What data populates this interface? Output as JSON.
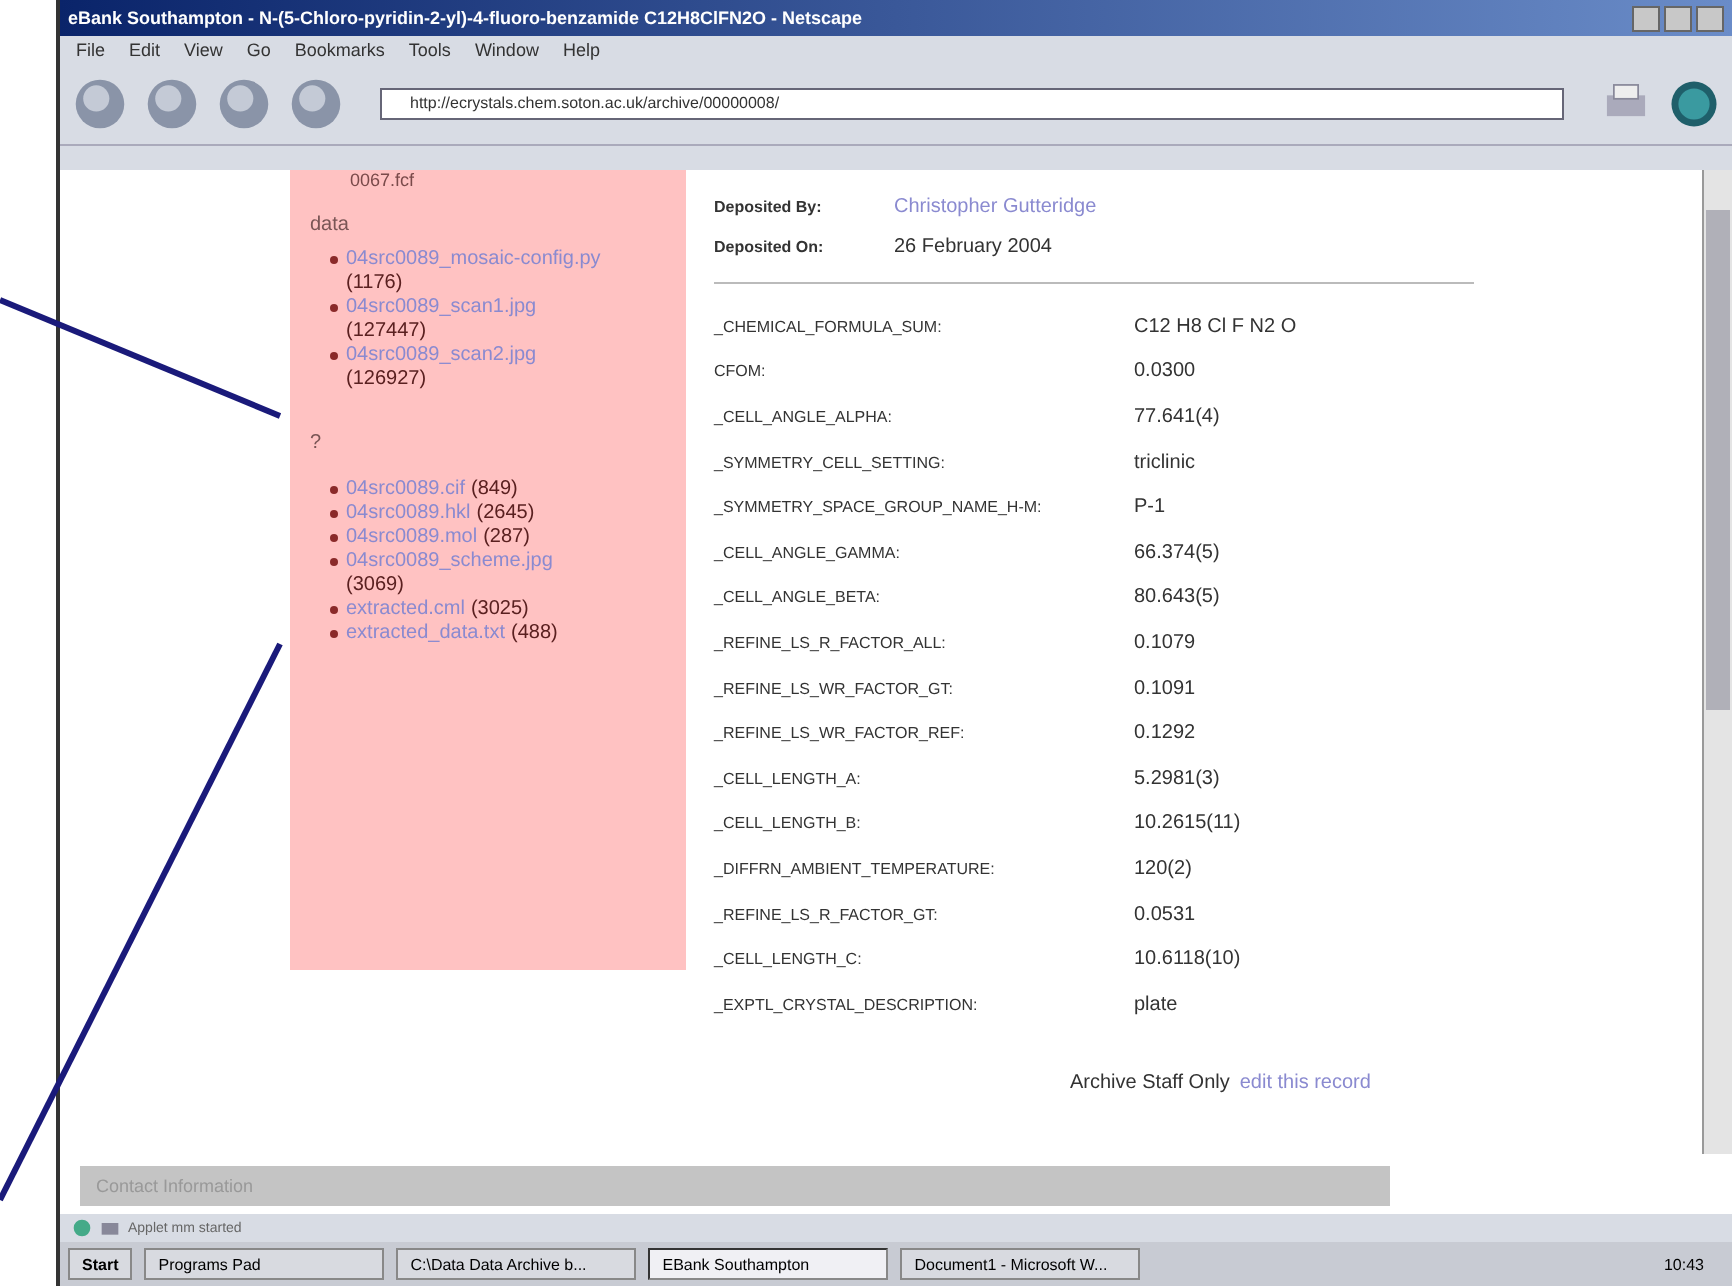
{
  "window": {
    "title": "eBank Southampton - N-(5-Chloro-pyridin-2-yl)-4-fluoro-benzamide C12H8ClFN2O - Netscape"
  },
  "menu": [
    "File",
    "Edit",
    "View",
    "Go",
    "Bookmarks",
    "Tools",
    "Window",
    "Help"
  ],
  "address_bar": {
    "value": "http://ecrystals.chem.soton.ac.uk/archive/00000008/"
  },
  "sidebar": {
    "top_text": "0067.fcf",
    "sections": [
      {
        "heading": "data",
        "files": [
          {
            "name": "04src0089_mosaic-config.py",
            "size": "(1176)"
          },
          {
            "name": "04src0089_scan1.jpg",
            "size": "(127447)"
          },
          {
            "name": "04src0089_scan2.jpg",
            "size": "(126927)"
          }
        ]
      },
      {
        "heading": "?",
        "files": [
          {
            "name": "04src0089.cif",
            "size": "(849)"
          },
          {
            "name": "04src0089.hkl",
            "size": "(2645)"
          },
          {
            "name": "04src0089.mol",
            "size": "(287)"
          },
          {
            "name": "04src0089_scheme.jpg",
            "size": "(3069)"
          },
          {
            "name": "extracted.cml",
            "size": "(3025)"
          },
          {
            "name": "extracted_data.txt",
            "size": "(488)"
          }
        ]
      }
    ]
  },
  "deposit": [
    {
      "label": "Deposited By:",
      "value": "Christopher Gutteridge",
      "kind": "link"
    },
    {
      "label": "Deposited On:",
      "value": "26 February 2004",
      "kind": "text"
    }
  ],
  "properties": [
    {
      "key": "_CHEMICAL_FORMULA_SUM:",
      "value": "C12 H8 Cl F N2 O"
    },
    {
      "key": "CFOM:",
      "value": "0.0300"
    },
    {
      "key": "_CELL_ANGLE_ALPHA:",
      "value": "77.641(4)"
    },
    {
      "key": "_SYMMETRY_CELL_SETTING:",
      "value": "triclinic"
    },
    {
      "key": "_SYMMETRY_SPACE_GROUP_NAME_H-M:",
      "value": "P-1"
    },
    {
      "key": "_CELL_ANGLE_GAMMA:",
      "value": "66.374(5)"
    },
    {
      "key": "_CELL_ANGLE_BETA:",
      "value": "80.643(5)"
    },
    {
      "key": "_REFINE_LS_R_FACTOR_ALL:",
      "value": "0.1079"
    },
    {
      "key": "_REFINE_LS_WR_FACTOR_GT:",
      "value": "0.1091"
    },
    {
      "key": "_REFINE_LS_WR_FACTOR_REF:",
      "value": "0.1292"
    },
    {
      "key": "_CELL_LENGTH_A:",
      "value": "5.2981(3)"
    },
    {
      "key": "_CELL_LENGTH_B:",
      "value": "10.2615(11)"
    },
    {
      "key": "_DIFFRN_AMBIENT_TEMPERATURE:",
      "value": "120(2)"
    },
    {
      "key": "_REFINE_LS_R_FACTOR_GT:",
      "value": "0.0531"
    },
    {
      "key": "_CELL_LENGTH_C:",
      "value": "10.6118(10)"
    },
    {
      "key": "_EXPTL_CRYSTAL_DESCRIPTION:",
      "value": "plate"
    }
  ],
  "footer": {
    "text": "Archive Staff Only",
    "link": "edit this record"
  },
  "contact_bar": "Contact Information",
  "status_text": "Applet mm started",
  "taskbar": {
    "start": "Start",
    "items": [
      {
        "label": "Programs Pad",
        "selected": false
      },
      {
        "label": "C:\\Data Data Archive b...",
        "selected": false
      },
      {
        "label": "EBank Southampton",
        "selected": true
      },
      {
        "label": "Document1 - Microsoft W...",
        "selected": false
      }
    ],
    "clock": "10:43"
  }
}
